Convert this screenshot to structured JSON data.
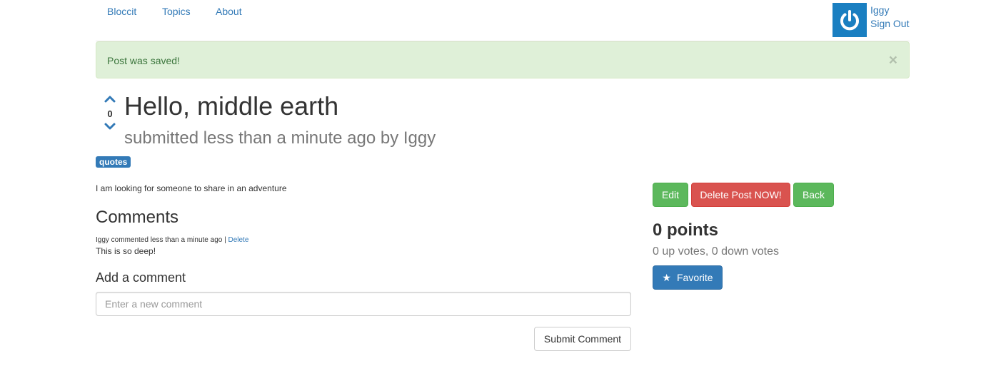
{
  "nav": {
    "brand": "Bloccit",
    "topics": "Topics",
    "about": "About",
    "user_name": "Iggy",
    "sign_out": "Sign Out",
    "avatar_color": "#1a7fc1"
  },
  "alert": {
    "message": "Post was saved!",
    "close": "×"
  },
  "post": {
    "vote_count": "0",
    "title": "Hello, middle earth",
    "subtitle": "submitted less than a minute ago by Iggy",
    "label": "quotes",
    "body": "I am looking for someone to share in an adventure"
  },
  "comments": {
    "heading": "Comments",
    "items": [
      {
        "meta": "Iggy commented less than a minute ago | ",
        "delete": "Delete",
        "body": "This is so deep!"
      }
    ],
    "add_heading": "Add a comment",
    "placeholder": "Enter a new comment",
    "submit": "Submit Comment"
  },
  "sidebar": {
    "edit": "Edit",
    "delete": "Delete Post NOW!",
    "back": "Back",
    "points": "0 points",
    "votes": "0 up votes, 0 down votes",
    "favorite": "Favorite",
    "colors": {
      "success": "#5cb85c",
      "danger": "#d9534f",
      "primary": "#337ab7"
    }
  }
}
